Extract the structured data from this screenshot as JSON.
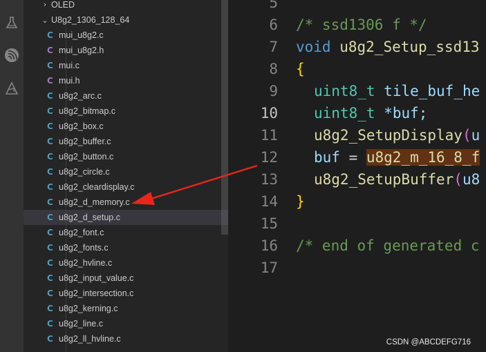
{
  "explorer": {
    "collapsed_folder": "OLED",
    "open_folder": "U8g2_1306_128_64",
    "files": [
      {
        "name": "mui_u8g2.c",
        "type": "c"
      },
      {
        "name": "mui_u8g2.h",
        "type": "h"
      },
      {
        "name": "mui.c",
        "type": "c"
      },
      {
        "name": "mui.h",
        "type": "h"
      },
      {
        "name": "u8g2_arc.c",
        "type": "c"
      },
      {
        "name": "u8g2_bitmap.c",
        "type": "c"
      },
      {
        "name": "u8g2_box.c",
        "type": "c"
      },
      {
        "name": "u8g2_buffer.c",
        "type": "c"
      },
      {
        "name": "u8g2_button.c",
        "type": "c"
      },
      {
        "name": "u8g2_circle.c",
        "type": "c"
      },
      {
        "name": "u8g2_cleardisplay.c",
        "type": "c"
      },
      {
        "name": "u8g2_d_memory.c",
        "type": "c"
      },
      {
        "name": "u8g2_d_setup.c",
        "type": "c"
      },
      {
        "name": "u8g2_font.c",
        "type": "c"
      },
      {
        "name": "u8g2_fonts.c",
        "type": "c"
      },
      {
        "name": "u8g2_hvline.c",
        "type": "c"
      },
      {
        "name": "u8g2_input_value.c",
        "type": "c"
      },
      {
        "name": "u8g2_intersection.c",
        "type": "c"
      },
      {
        "name": "u8g2_kerning.c",
        "type": "c"
      },
      {
        "name": "u8g2_line.c",
        "type": "c"
      },
      {
        "name": "u8g2_ll_hvline.c",
        "type": "c"
      }
    ],
    "selected_file": "u8g2_d_setup.c",
    "file_icon_glyph_c": "C",
    "file_icon_glyph_h": "C"
  },
  "editor": {
    "active_line": "10",
    "lines": [
      {
        "num": "5"
      },
      {
        "num": "6",
        "comment": "/* ssd1306 f */"
      },
      {
        "num": "7",
        "kw": "void",
        "fn": "u8g2_Setup_ssd13"
      },
      {
        "num": "8",
        "brace": "{"
      },
      {
        "num": "9",
        "type": "uint8_t",
        "rest": "tile_buf_he"
      },
      {
        "num": "10",
        "type": "uint8_t",
        "rest": "*buf;"
      },
      {
        "num": "11",
        "fn": "u8g2_SetupDisplay",
        "paren": "(",
        "rest": "u"
      },
      {
        "num": "12",
        "var": "buf",
        "op": " = ",
        "hl": "u8g2_m_16_8_f"
      },
      {
        "num": "13",
        "fn": "u8g2_SetupBuffer",
        "paren": "(",
        "rest": "u8"
      },
      {
        "num": "14",
        "brace": "}"
      },
      {
        "num": "15"
      },
      {
        "num": "16",
        "comment": "/* end of generated c"
      },
      {
        "num": "17"
      }
    ]
  },
  "watermark": "CSDN @ABCDEFG716",
  "colors": {
    "annotation_arrow": "#e8261b",
    "selection": "#37373d",
    "highlight": "#613214"
  },
  "icons": [
    "flask-icon",
    "wifi-icon",
    "triangle-tool-icon"
  ]
}
